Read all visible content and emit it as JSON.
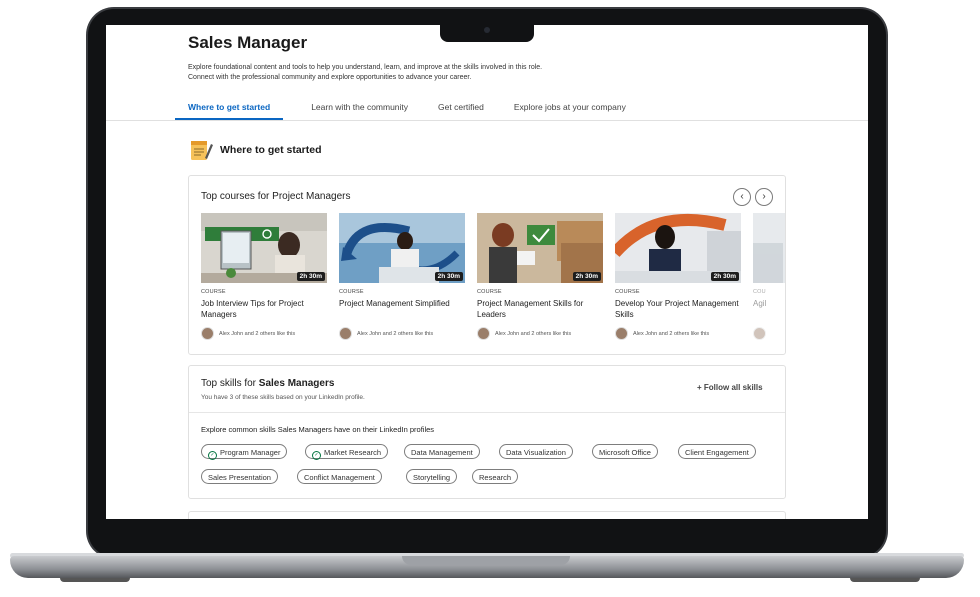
{
  "page": {
    "title": "Sales Manager",
    "description_line1": "Explore foundational content and tools to help you understand, learn, and improve at the skills involved in this role.",
    "description_line2": "Connect with the professional community and explore opportunities to advance your career."
  },
  "tabs": [
    {
      "label": "Where to get started",
      "active": true
    },
    {
      "label": "Learn with the community",
      "active": false
    },
    {
      "label": "Get certified",
      "active": false
    },
    {
      "label": "Explore jobs at your company",
      "active": false
    }
  ],
  "section": {
    "title": "Where to get started",
    "icon": "notepad-icon"
  },
  "courses": {
    "title": "Top courses for Project Managers",
    "prev_icon": "‹",
    "next_icon": "›",
    "items": [
      {
        "type": "COURSE",
        "name": "Job Interview Tips for Project Managers",
        "duration": "2h 30m",
        "likes": "Alex John and 2 others like this"
      },
      {
        "type": "COURSE",
        "name": "Project Management Simplified",
        "duration": "2h 30m",
        "likes": "Alex John and 2 others like this"
      },
      {
        "type": "COURSE",
        "name": "Project Management Skills for Leaders",
        "duration": "2h 30m",
        "likes": "Alex John and 2 others like this"
      },
      {
        "type": "COURSE",
        "name": "Develop Your Project Management Skills",
        "duration": "2h 30m",
        "likes": "Alex John and 2 others like this"
      },
      {
        "type": "COU",
        "name": "Agil",
        "duration": "",
        "likes": ""
      }
    ]
  },
  "skills": {
    "title_prefix": "Top skills for ",
    "title_role": "Sales Managers",
    "subtitle": "You have 3 of these skills based on your LinkedIn profile.",
    "follow_label": "+ Follow all skills",
    "explore_label": "Explore common skills Sales Managers have on their LinkedIn profiles",
    "pills": [
      {
        "label": "Program Manager",
        "has": true
      },
      {
        "label": "Market Research",
        "has": true
      },
      {
        "label": "Data Management",
        "has": false
      },
      {
        "label": "Data Visualization",
        "has": false
      },
      {
        "label": "Microsoft Office",
        "has": false
      },
      {
        "label": "Client Engagement",
        "has": false
      },
      {
        "label": "Sales Presentation",
        "has": false
      },
      {
        "label": "Conflict Management",
        "has": false
      },
      {
        "label": "Storytelling",
        "has": false
      },
      {
        "label": "Research",
        "has": false
      }
    ]
  },
  "colors": {
    "accent": "#0a66c2",
    "check": "#057642"
  }
}
